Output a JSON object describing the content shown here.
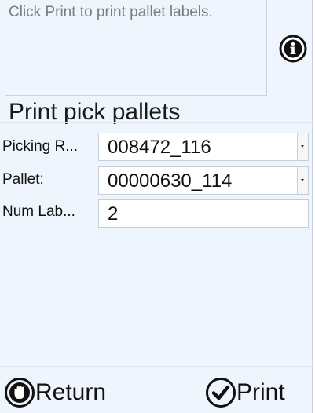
{
  "message": {
    "text": "Click Print to print pallet labels."
  },
  "section": {
    "title": "Print pick pallets"
  },
  "fields": {
    "picking_run": {
      "label": "Picking R...",
      "value": "008472_116"
    },
    "pallet": {
      "label": "Pallet:",
      "value": "00000630_114"
    },
    "num_labels": {
      "label": "Num Lab...",
      "value": "2"
    }
  },
  "footer": {
    "return_label": "Return",
    "print_label": "Print"
  },
  "icons": {
    "info": "info-icon",
    "return": "stop-hand-icon",
    "print": "checkmark-circle-icon"
  }
}
